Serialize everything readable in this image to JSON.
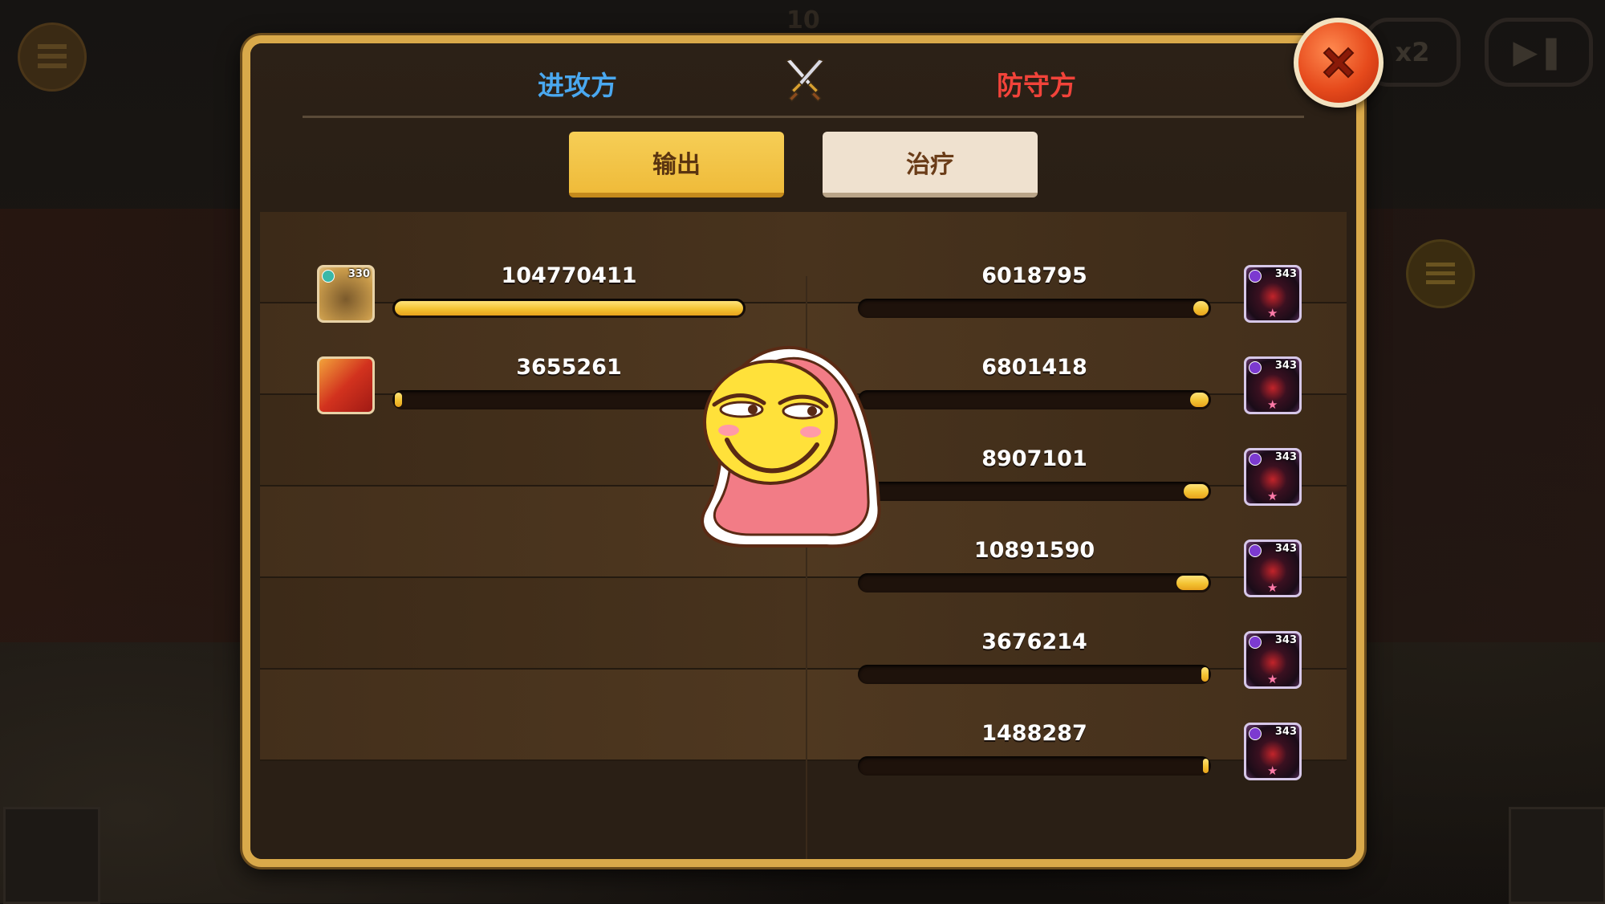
{
  "background": {
    "top_number": "10",
    "speed_label": "x2"
  },
  "dialog": {
    "attacker_label": "进攻方",
    "defender_label": "防守方",
    "tabs": [
      {
        "label": "输出",
        "active": true
      },
      {
        "label": "治疗",
        "active": false
      }
    ],
    "colors": {
      "attacker": "#4aa8f0",
      "defender": "#f2433a",
      "active_tab": "#f6ce56",
      "inactive_tab": "#efe1cf",
      "bar_fill": "#f3c232",
      "frame": "#d9a94a"
    },
    "attackers": [
      {
        "value": "104770411",
        "portrait_level": "330",
        "portrait_icon": "armored-beast-portrait",
        "bar_fraction": 1.0
      },
      {
        "value": "3655261",
        "portrait_level": "",
        "portrait_icon": "red-dragon-portrait",
        "bar_fraction": 0.035
      }
    ],
    "defenders": [
      {
        "value": "6018795",
        "portrait_level": "343",
        "portrait_icon": "dark-knight-portrait",
        "bar_fraction": 0.057
      },
      {
        "value": "6801418",
        "portrait_level": "343",
        "portrait_icon": "dark-knight-portrait",
        "bar_fraction": 0.065
      },
      {
        "value": "8907101",
        "portrait_level": "343",
        "portrait_icon": "dark-knight-portrait",
        "bar_fraction": 0.085
      },
      {
        "value": "10891590",
        "portrait_level": "343",
        "portrait_icon": "dark-knight-portrait",
        "bar_fraction": 0.104
      },
      {
        "value": "3676214",
        "portrait_level": "343",
        "portrait_icon": "dark-knight-portrait",
        "bar_fraction": 0.035
      },
      {
        "value": "1488287",
        "portrait_level": "343",
        "portrait_icon": "dark-knight-portrait",
        "bar_fraction": 0.014
      }
    ],
    "close_icon": "close-icon"
  }
}
